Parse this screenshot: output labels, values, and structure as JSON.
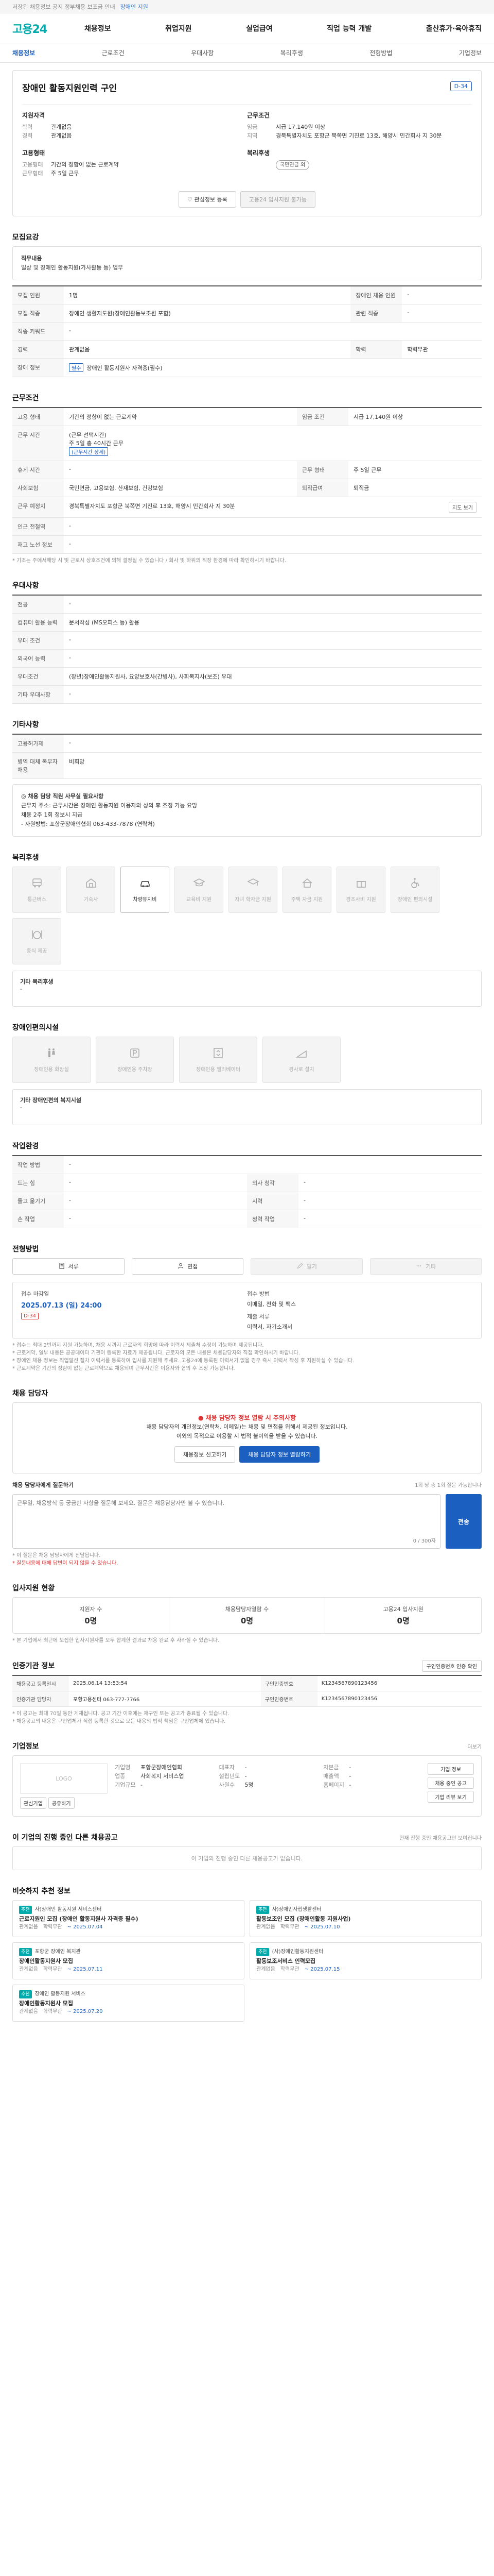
{
  "topbar": {
    "text": "저장된 채용정보 공지 정부채용 보조금 안내",
    "link": "장애인 지원"
  },
  "header": {
    "logo_main": "고용",
    "logo_sub": "24",
    "nav": [
      "채용정보",
      "취업지원",
      "실업급여",
      "직업 능력 개발",
      "출산휴가·육아휴직"
    ]
  },
  "subnav": {
    "items": [
      "채용정보",
      "근로조건",
      "우대사항",
      "복리후생",
      "전형방법",
      "기업정보"
    ],
    "active_index": 0
  },
  "job": {
    "dday": "D-34",
    "title": "장애인 활동지원인력 구인",
    "summary": {
      "left_groups": [
        {
          "title": "지원자격",
          "rows": [
            {
              "k": "학력",
              "v": "관계없음"
            },
            {
              "k": "경력",
              "v": "관계없음"
            }
          ]
        },
        {
          "title": "고용형태",
          "rows": [
            {
              "k": "고용형태",
              "v": "기간의 정함이 없는 근로계약"
            },
            {
              "k": "근무형태",
              "v": "주 5일 근무"
            }
          ]
        }
      ],
      "right_groups": [
        {
          "title": "근무조건",
          "rows": [
            {
              "k": "임금",
              "v": "시급 17,140원 이상"
            },
            {
              "k": "지역",
              "v": "경북특별자치도 포항군 북쪽면 기진로 13호, 해양시 민간회사 지 30분"
            }
          ]
        },
        {
          "title": "복리후생",
          "rows": [
            {
              "k": "",
              "v": "국민연금 외"
            }
          ]
        }
      ]
    },
    "buttons": {
      "like": "관심정보 등록",
      "apply": "고용24 입사지원 불가능"
    }
  },
  "recruit": {
    "title": "모집요강",
    "duty_label": "직무내용",
    "duty_text": "일상 및 장애인 활동지원(가사활동 등) 업무",
    "table": [
      {
        "k": "모집 인원",
        "v": "1명",
        "k2": "장애인 채용 인원",
        "v2": "-"
      },
      {
        "k": "모집 직종",
        "v": "장애인 생활지도원(장애인활동보조원 포함)",
        "k2": "관련 직종",
        "v2": "-"
      },
      {
        "k": "직종 키워드",
        "v": "-",
        "k2": "",
        "v2": ""
      },
      {
        "k": "경력",
        "v": "관계없음",
        "k2": "학력",
        "v2": "학력무관"
      },
      {
        "k": "장애 정보",
        "v": "장애인 활동지원사 자격증(필수)",
        "k2": "",
        "v2": "",
        "tag": "필수"
      }
    ]
  },
  "condition": {
    "title": "근무조건",
    "rows": [
      {
        "k": "고용 형태",
        "v": "기간의 정함이 없는 근로계약",
        "k2": "임금 조건",
        "v2": "시급 17,140원 이상"
      },
      {
        "k": "근무 시간",
        "v": "(근무 선택시간)\n주 5일 총 40시간 근무\n(근무시간 상세)",
        "k2": "",
        "v2": ""
      },
      {
        "k": "휴게 시간",
        "v": "-",
        "k2": "근무 형태",
        "v2": "주 5일 근무"
      },
      {
        "k": "사회보험",
        "v": "국민연금, 고용보험, 산재보험, 건강보험",
        "k2": "퇴직급여",
        "v2": "퇴직금"
      },
      {
        "k": "근무 예정지",
        "v": "경북특별자치도 포항군 북쪽면 기진로 13호, 해양시 민간회사 지 30분",
        "k2": "",
        "v2": "",
        "btn": "지도 보기"
      },
      {
        "k": "인근 전철역",
        "v": "-",
        "k2": "",
        "v2": ""
      },
      {
        "k": "재고 노선 정보",
        "v": "-",
        "k2": "",
        "v2": ""
      }
    ],
    "note": "* 기조는 주에서해당 시 및 근로시 상호조건에 의해 결정될 수 있습니다 / 회사 및 하위의 직장 환경에 따라 확인하시기 바랍니다."
  },
  "prefer": {
    "title": "우대사항",
    "rows": [
      {
        "k": "전공",
        "v": "-"
      },
      {
        "k": "컴퓨터 활용 능력",
        "v": "문서작성 (MS오피스 등) 활용"
      },
      {
        "k": "우대 조건",
        "v": "-"
      },
      {
        "k": "외국어 능력",
        "v": "-"
      },
      {
        "k": "우대조건",
        "v": "(장년)장애인활동지원사, 요양보호사(간병사), 사회복지사(보조) 우대"
      },
      {
        "k": "기타 우대사항",
        "v": "-"
      }
    ]
  },
  "etc": {
    "title": "기타사항",
    "rows": [
      {
        "k": "고용허가제",
        "v": "-"
      },
      {
        "k": "병역 대체 복무자 채용",
        "v": "비희망"
      }
    ],
    "box_title": "◎ 채용 담당 직원 사무실 필요사항",
    "box_lines": [
      "근무지 주소: 근무시간은 장애인 활동지원 이용자와 상의 후 조정 가능 요망",
      "채용 2주 1회 정보시 지급",
      "- 자원방법: 포항군장애인협회 063-433-7878 (연락처)"
    ]
  },
  "welfare": {
    "title": "복리후생",
    "tiles": [
      {
        "label": "통근버스",
        "icon": "bus-icon",
        "on": false
      },
      {
        "label": "기숙사",
        "icon": "dorm-icon",
        "on": false
      },
      {
        "label": "차량유지비",
        "icon": "car-icon",
        "on": true
      },
      {
        "label": "교육비 지원",
        "icon": "education-icon",
        "on": false
      },
      {
        "label": "자녀 학자금 지원",
        "icon": "graduation-icon",
        "on": false
      },
      {
        "label": "주택 자금 지원",
        "icon": "house-icon",
        "on": false
      },
      {
        "label": "경조사비 지원",
        "icon": "gift-icon",
        "on": false
      },
      {
        "label": "장애인 편의시설",
        "icon": "wheelchair-icon",
        "on": false
      },
      {
        "label": "중식 제공",
        "icon": "meal-icon",
        "on": false
      }
    ],
    "etc_title": "기타 복리후생",
    "etc_value": "-"
  },
  "facility": {
    "title": "장애인편의시설",
    "tiles": [
      {
        "label": "장애인용 화장실",
        "icon": "toilet-icon"
      },
      {
        "label": "장애인용 주차장",
        "icon": "parking-icon"
      },
      {
        "label": "장애인용 엘리베이터",
        "icon": "elevator-icon"
      },
      {
        "label": "경사로 설치",
        "icon": "ramp-icon"
      }
    ],
    "etc_title": "기타 장애인편의 복지시설",
    "etc_value": "-"
  },
  "work_env": {
    "title": "작업환경",
    "rows": [
      {
        "k": "작업 방법",
        "v": "-",
        "k2": "",
        "v2": ""
      },
      {
        "k": "드는 힘",
        "v": "-",
        "k2": "의사 청각",
        "v2": "-"
      },
      {
        "k": "들고 옮기기",
        "v": "-",
        "k2": "시력",
        "v2": "-"
      },
      {
        "k": "손 작업",
        "v": "-",
        "k2": "청력 작업",
        "v2": "-"
      }
    ]
  },
  "method": {
    "title": "전형방법",
    "methods": [
      {
        "label": "서류",
        "icon": "document-icon",
        "on": true
      },
      {
        "label": "면접",
        "icon": "interview-icon",
        "on": true
      },
      {
        "label": "필기",
        "icon": "pen-icon",
        "on": false
      },
      {
        "label": "기타",
        "icon": "etc-icon",
        "on": false
      }
    ],
    "period": {
      "label1": "접수 마감일",
      "deadline": "2025.07.13 (일) 24:00",
      "dday": "D-34",
      "label2": "접수 방법",
      "how": "이메일, 전화 및 팩스",
      "label3": "제출 서류",
      "docs": "이력서, 자기소개서"
    },
    "notes": [
      "* 접수는 최대 2번까지 지원 가능하며, 채용 시까지 근로자의 희망에 따라 이력서 제출처 수정이 가능하며 제공됩니다.",
      "* 근로계약, 일부 내용은 공공데이터 기관이 등록한 자료가 제공됩니다. 근로자의 모든 내용은 채용담당자와 직접 확인하시기 바랍니다.",
      "* 장애인 채용 정보는 직업알선 절차 이력서를 등록하여 입사를 지원해 주세요. 고용24에 등록된 이력서가 없을 경우 즉시 이력서 작성 후 지원하실 수 있습니다.",
      "* 근로계약은 기간의 정함이 없는 근로계약으로 채용되며 근무시간은 이용자와 협의 후 조정 가능합니다."
    ]
  },
  "contact": {
    "title": "채용 담당자",
    "alert": "채용 담당자 정보 열람 시 주의사항",
    "lines": [
      "채용 담당자의 개인정보(연락처, 이메일)는 채용 및 면접을 위해서 제공된 정보입니다.",
      "이외의 목적으로 이용할 시 법적 불이익을 받을 수 있습니다."
    ],
    "btn1": "채용정보 신고하기",
    "btn2": "채용 담당자 정보 열람하기",
    "qa_label": "채용 담당자에게 질문하기",
    "qa_hint": "1회 당 총 1회 질문 가능합니다",
    "qa_placeholder": "근무일, 채용방식 등 궁금한 사항을 질문해 보세요. 질문은 채용담당자만 볼 수 있습니다.",
    "qa_count": "0 / 300자",
    "qa_submit": "전송",
    "qa_notes": [
      "* 이 질문은 채용 담당자에게 전달됩니다.",
      "* 질문내용에 대해 답변이 되지 않을 수 있습니다."
    ]
  },
  "stats": {
    "title": "입사지원 현황",
    "items": [
      {
        "label": "지원자 수",
        "value": "0명"
      },
      {
        "label": "채용담당자열람 수",
        "value": "0명"
      },
      {
        "label": "고용24 입사지원",
        "value": "0명"
      }
    ],
    "note": "* 본 기업에서 최근에 모집한 입사지원자를 모두 합계한 결과로 채용 완료 후 사라질 수 있습니다."
  },
  "info": {
    "title": "인증기관 정보",
    "btn": "구인인증번호 인증 확인",
    "rows": [
      {
        "k": "채용공고 등록일시",
        "v": "2025.06.14 13:53:54",
        "k2": "구인인증번호",
        "v2": "K1234567890123456"
      },
      {
        "k": "인증기관 담당자",
        "v": "포항고용센터 063-777-7766",
        "k2": "구인인증번호",
        "v2": "K1234567890123456"
      }
    ],
    "notes": [
      "* 이 공고는 최대 70일 동안 게재됩니다. 공고 기간 이후에는 재구인 또는 공고가 종료될 수 있습니다.",
      "* 채용공고의 내용은 구인업체가 직접 등록한 것으로 모든 내용의 법적 책임은 구인업체에 있습니다."
    ]
  },
  "company": {
    "title": "기업정보",
    "more": "더보기",
    "logo_text": "LOGO",
    "logo_btn1": "관심기업",
    "logo_btn2": "공유하기",
    "cols": [
      [
        {
          "k": "기업명",
          "v": "포항군장애인협회"
        },
        {
          "k": "업종",
          "v": "사회복지 서비스업"
        },
        {
          "k": "기업규모",
          "v": "-"
        }
      ],
      [
        {
          "k": "대표자",
          "v": "-"
        },
        {
          "k": "설립년도",
          "v": "-"
        },
        {
          "k": "사원수",
          "v": "5명"
        }
      ],
      [
        {
          "k": "자본금",
          "v": "-"
        },
        {
          "k": "매출액",
          "v": "-"
        },
        {
          "k": "홈페이지",
          "v": "-"
        }
      ]
    ],
    "side_btns": [
      "기업 정보",
      "채용 중인 공고",
      "기업 리뷰 보기"
    ]
  },
  "other_jobs": {
    "title": "이 기업의 진행 중인 다른 채용공고",
    "more": "현재 진행 중인 채용공고만 보여집니다",
    "empty": "이 기업의 진행 중인 다른 채용공고가 없습니다."
  },
  "recommend": {
    "title": "비슷하지 추천 정보",
    "items": [
      {
        "tag": "추천",
        "org": "사)장애인 활동지원 서비스센터",
        "title": "근로지원인 모집 (장애인 활동지원사 자격증 필수)",
        "m1": "관계없음",
        "m2": "학력무관",
        "deadline": "~ 2025.07.04"
      },
      {
        "tag": "추천",
        "org": "사)장애인자립생활센터",
        "title": "활동보조인 모집 (장애인활동 지원사업)",
        "m1": "관계없음",
        "m2": "학력무관",
        "deadline": "~ 2025.07.10"
      },
      {
        "tag": "추천",
        "org": "포항군 장애인 복지관",
        "title": "장애인활동지원사 모집",
        "m1": "관계없음",
        "m2": "학력무관",
        "deadline": "~ 2025.07.11"
      },
      {
        "tag": "추천",
        "org": "(사)장애인활동지원센터",
        "title": "활동보조서비스 인력모집",
        "m1": "관계없음",
        "m2": "학력무관",
        "deadline": "~ 2025.07.15"
      },
      {
        "tag": "추천",
        "org": "장애인 활동지원 서비스",
        "title": "장애인활동지원사 모집",
        "m1": "관계없음",
        "m2": "학력무관",
        "deadline": "~ 2025.07.20"
      }
    ]
  },
  "colors": {
    "brand": "#1b5fc1",
    "accent": "#00aaaa",
    "alert": "#dd3333"
  }
}
